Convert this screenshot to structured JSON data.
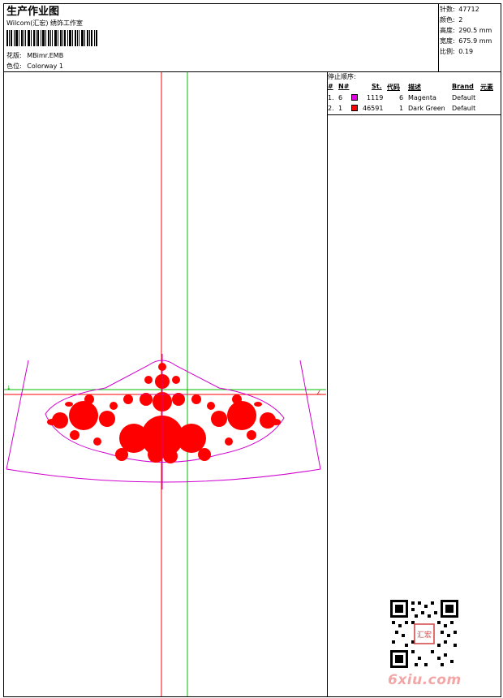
{
  "header": {
    "title": "生产作业图",
    "subtitle": "Wilcom(汇宏) 绣饰工作室",
    "design_label": "花版:",
    "design_value": "MBimr.EMB",
    "colorway_label": "色位:",
    "colorway_value": "Colorway 1"
  },
  "stats": [
    {
      "label": "针数:",
      "value": "47712"
    },
    {
      "label": "颜色:",
      "value": "2"
    },
    {
      "label": "高度:",
      "value": "290.5 mm"
    },
    {
      "label": "宽度:",
      "value": "675.9 mm"
    },
    {
      "label": "比例:",
      "value": "0.19"
    }
  ],
  "stop_sequence": {
    "title": "停止顺序:",
    "columns": [
      "#",
      "N#",
      "St.",
      "代码",
      "描述",
      "Brand",
      "元素"
    ],
    "rows": [
      {
        "index": "1.",
        "n": "6",
        "color": "#e000e0",
        "stitches": "1119",
        "code": "6",
        "description": "Magenta",
        "brand": "Default"
      },
      {
        "index": "2.",
        "n": "1",
        "color": "#ff0000",
        "stitches": "46591",
        "code": "1",
        "description": "Dark Green",
        "brand": "Default"
      }
    ]
  },
  "canvas": {
    "vertical_guide_color": "#ff0000",
    "horizontal_guide_color": "#00c000",
    "outline_color": "#d000d0",
    "fill_color": "#ff0000"
  },
  "watermark": {
    "text": "6xiu.com",
    "stamp_text": "汇宏"
  }
}
